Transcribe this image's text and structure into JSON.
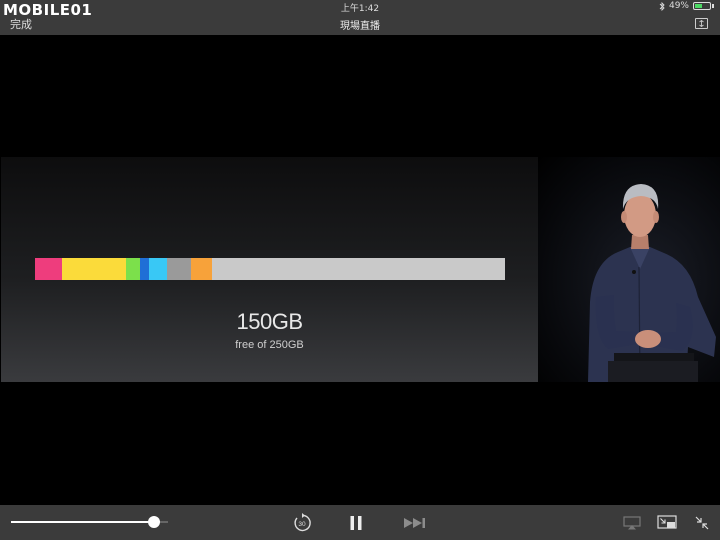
{
  "watermark": {
    "text": "MOBILE01"
  },
  "status": {
    "time": "上午1:42",
    "battery": "49%",
    "battery_level": 0.49
  },
  "nav": {
    "done_label": "完成",
    "title": "現場直播"
  },
  "slide": {
    "storage_total": "150GB",
    "storage_subtitle": "free of 250GB",
    "segments": [
      {
        "color": "#ee3d7d",
        "fraction": 0.058
      },
      {
        "color": "#fbdb3a",
        "fraction": 0.135
      },
      {
        "color": "#7ce04b",
        "fraction": 0.03
      },
      {
        "color": "#1f6fd6",
        "fraction": 0.02
      },
      {
        "color": "#39c8f5",
        "fraction": 0.038
      },
      {
        "color": "#9a9a9a",
        "fraction": 0.05
      },
      {
        "color": "#f7a23a",
        "fraction": 0.045
      },
      {
        "color": "#c9c9c9",
        "fraction": 0.624
      }
    ]
  },
  "player": {
    "volume_level": 0.91,
    "icons": {
      "skip_back": "skip-back-30-icon",
      "pause": "pause-icon",
      "skip_forward": "fast-forward-icon",
      "airplay": "airplay-icon",
      "pip": "picture-in-picture-icon",
      "collapse": "collapse-icon"
    },
    "skip_back_seconds": "30"
  }
}
